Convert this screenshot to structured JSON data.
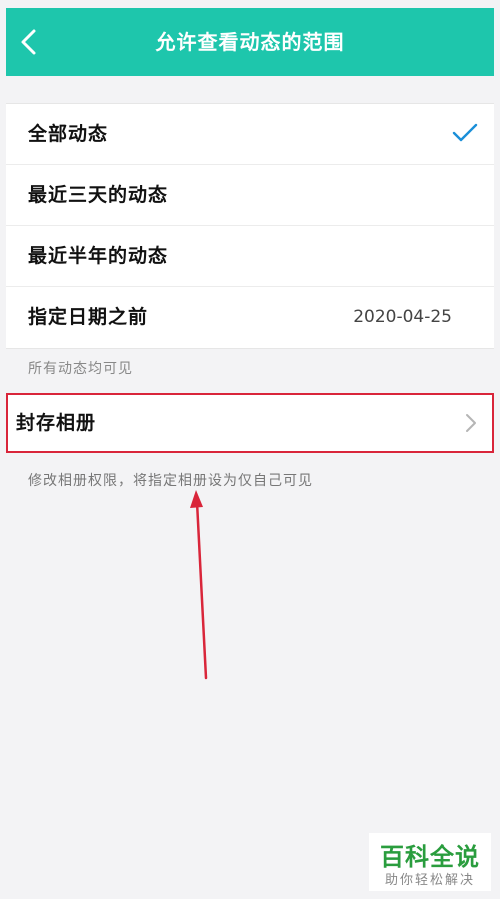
{
  "header": {
    "title": "允许查看动态的范围"
  },
  "options": [
    {
      "label": "全部动态",
      "selected": true
    },
    {
      "label": "最近三天的动态"
    },
    {
      "label": "最近半年的动态"
    },
    {
      "label": "指定日期之前",
      "value": "2020-04-25"
    }
  ],
  "hint_visibility": "所有动态均可见",
  "archive": {
    "label": "封存相册"
  },
  "hint_archive": "修改相册权限，将指定相册设为仅自己可见",
  "watermark": {
    "title": "百科全说",
    "subtitle": "助你轻松解决"
  },
  "colors": {
    "header": "#1ec6ac",
    "check": "#1a8fd8",
    "highlight": "#d9253a",
    "watermark": "#2a9d3e"
  }
}
